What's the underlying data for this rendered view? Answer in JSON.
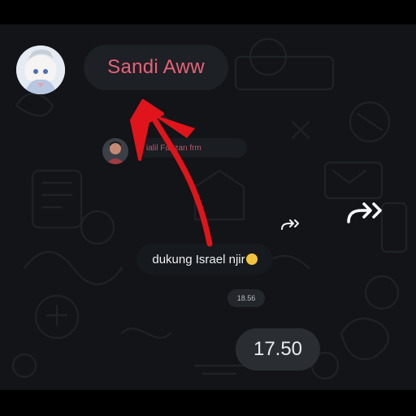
{
  "contact": {
    "name": "Sandi Aww",
    "name_color": "#e8627a"
  },
  "reply": {
    "sender_name": "ialil Fauzan frm"
  },
  "message": {
    "text": "dukung Israel njir",
    "emoji": "grinning-sweat-emoji"
  },
  "times": {
    "small": "18.56",
    "big": "17.50"
  },
  "annotation": {
    "arrow_color": "#e0141b"
  },
  "icons": {
    "forward": "forward-icon",
    "avatar": "avatar-icon"
  }
}
